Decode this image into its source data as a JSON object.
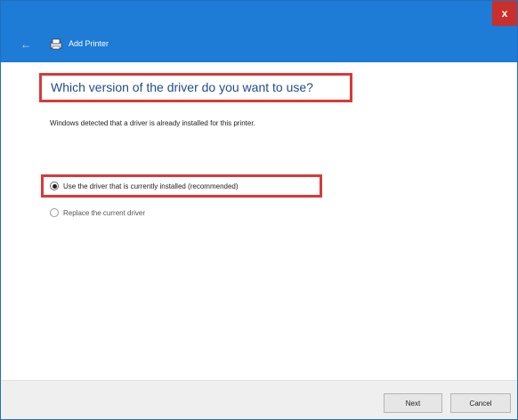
{
  "window": {
    "title": "Add Printer",
    "close_label": "x",
    "back_icon": "back-arrow-icon",
    "title_icon": "printer-icon",
    "colors": {
      "titlebar": "#1e7bd6",
      "close": "#c9302c",
      "highlight": "#d63a3a",
      "heading": "#1f4c8f"
    }
  },
  "main": {
    "heading": "Which version of the driver do you want to use?",
    "description": "Windows detected that a driver is already installed for this printer.",
    "options": [
      {
        "label": "Use the driver that is currently installed (recommended)",
        "selected": true
      },
      {
        "label": "Replace the current driver",
        "selected": false
      }
    ]
  },
  "footer": {
    "next_label": "Next",
    "cancel_label": "Cancel"
  }
}
